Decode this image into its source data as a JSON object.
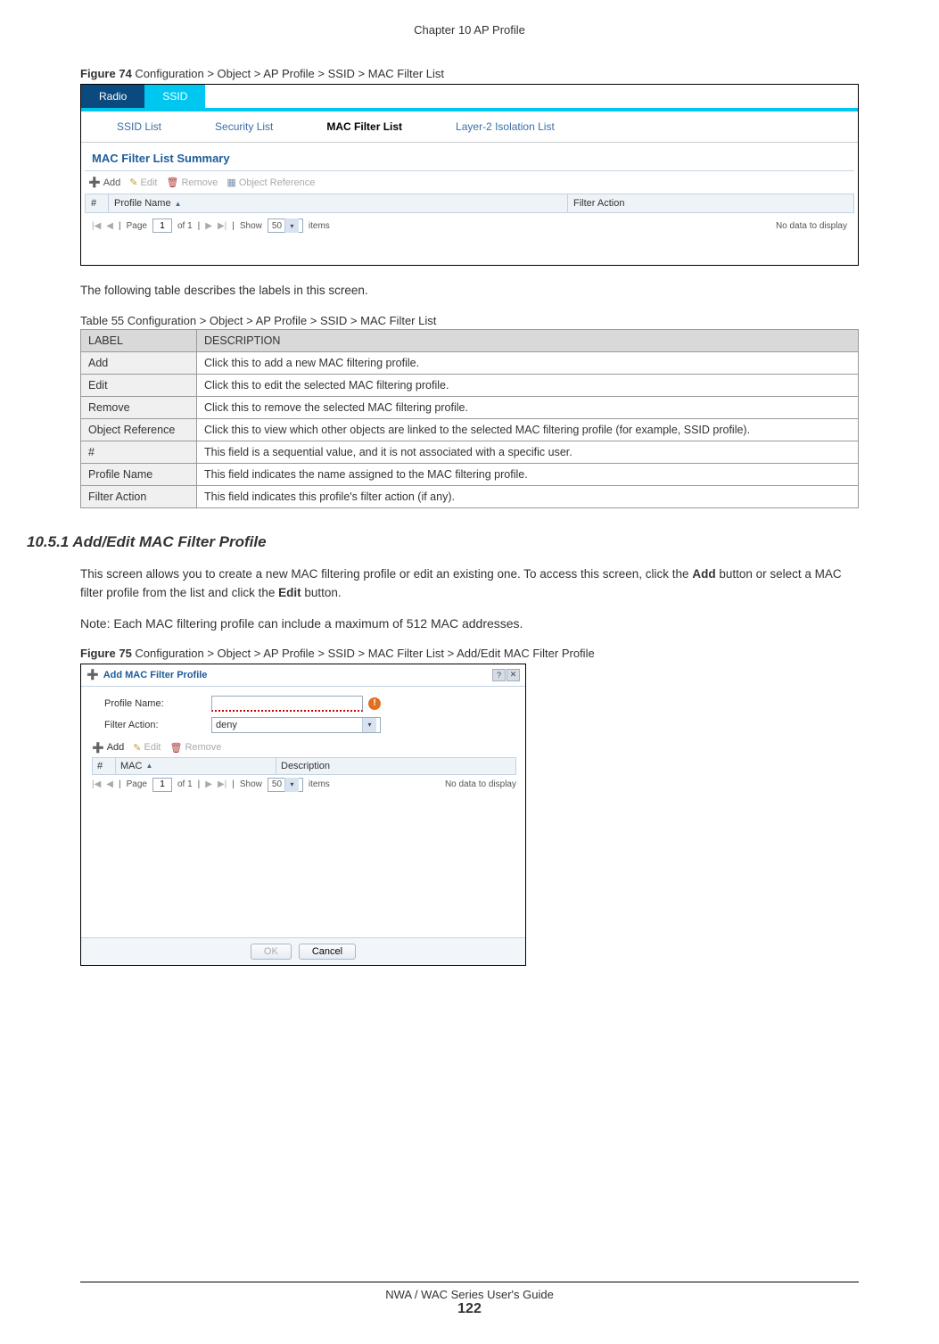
{
  "chapter_header": "Chapter 10 AP Profile",
  "figure74": {
    "caption_bold": "Figure 74",
    "caption_rest": "   Configuration > Object > AP Profile > SSID > MAC Filter List",
    "tab_radio": "Radio",
    "tab_ssid": "SSID",
    "subtabs": [
      "SSID List",
      "Security List",
      "MAC Filter List",
      "Layer-2 Isolation List"
    ],
    "section_title": "MAC Filter List Summary",
    "toolbar": {
      "add": "Add",
      "edit": "Edit",
      "remove": "Remove",
      "objref": "Object Reference"
    },
    "col_num": "#",
    "col_name": "Profile Name",
    "col_action": "Filter Action",
    "pager": {
      "page_lbl": "Page",
      "page_val": "1",
      "of": "of 1",
      "show": "Show",
      "show_val": "50",
      "items": "items",
      "nodata": "No data to display"
    }
  },
  "text_after_fig74": "The following table describes the labels in this screen.",
  "table55": {
    "caption": "Table 55   Configuration > Object > AP Profile > SSID > MAC Filter List",
    "head_label": "LABEL",
    "head_desc": "DESCRIPTION",
    "rows": [
      {
        "label": "Add",
        "desc": "Click this to add a new MAC filtering profile."
      },
      {
        "label": "Edit",
        "desc": "Click this to edit the selected MAC filtering profile."
      },
      {
        "label": "Remove",
        "desc": "Click this to remove the selected MAC filtering profile."
      },
      {
        "label": "Object Reference",
        "desc": "Click this to view which other objects are linked to the selected MAC filtering profile (for example, SSID profile)."
      },
      {
        "label": "#",
        "desc": "This field is a sequential value, and it is not associated with a specific user."
      },
      {
        "label": "Profile Name",
        "desc": "This field indicates the name assigned to the MAC filtering profile."
      },
      {
        "label": "Filter Action",
        "desc": "This field indicates this profile's filter action (if any)."
      }
    ]
  },
  "section_1051": {
    "heading": "10.5.1  Add/Edit MAC Filter Profile",
    "para1_a": "This screen allows you to create a new MAC filtering profile or edit an existing one. To access this screen, click the ",
    "para1_b1": "Add",
    "para1_c": " button or select a MAC filter profile from the list and click the ",
    "para1_b2": "Edit",
    "para1_d": " button.",
    "note": "Note: Each MAC filtering profile can include a maximum of 512 MAC addresses."
  },
  "figure75": {
    "caption_bold": "Figure 75",
    "caption_rest": "   Configuration > Object > AP Profile > SSID > MAC Filter List > Add/Edit MAC Filter Profile",
    "title": "Add MAC Filter Profile",
    "lbl_profile": "Profile Name:",
    "lbl_filter": "Filter Action:",
    "filter_value": "deny",
    "toolbar": {
      "add": "Add",
      "edit": "Edit",
      "remove": "Remove"
    },
    "col_num": "#",
    "col_mac": "MAC",
    "col_desc": "Description",
    "pager": {
      "page_lbl": "Page",
      "page_val": "1",
      "of": "of 1",
      "show": "Show",
      "show_val": "50",
      "items": "items",
      "nodata": "No data to display"
    },
    "btn_ok": "OK",
    "btn_cancel": "Cancel"
  },
  "footer": {
    "guide": "NWA / WAC Series User's Guide",
    "page": "122"
  }
}
